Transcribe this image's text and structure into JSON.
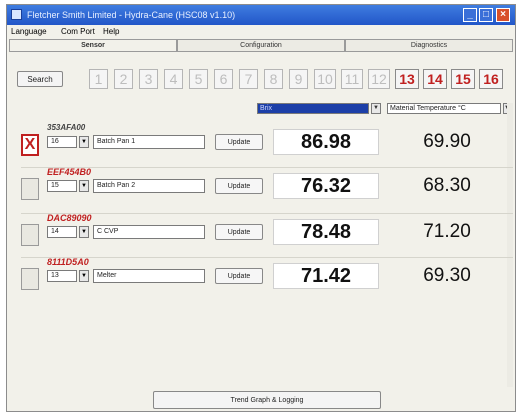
{
  "window": {
    "title": "Fletcher Smith Limited - Hydra-Cane (HSC08 v1.10)"
  },
  "menu": [
    "Language",
    "Com Port",
    "Help"
  ],
  "tabs": [
    {
      "label": "Sensor",
      "active": true
    },
    {
      "label": "Configuration",
      "active": false
    },
    {
      "label": "Diagnostics",
      "active": false
    }
  ],
  "search_label": "Search",
  "channel_buttons": [
    {
      "label": "1",
      "active": false
    },
    {
      "label": "2",
      "active": false
    },
    {
      "label": "3",
      "active": false
    },
    {
      "label": "4",
      "active": false
    },
    {
      "label": "5",
      "active": false
    },
    {
      "label": "6",
      "active": false
    },
    {
      "label": "7",
      "active": false
    },
    {
      "label": "8",
      "active": false
    },
    {
      "label": "9",
      "active": false
    },
    {
      "label": "10",
      "active": false
    },
    {
      "label": "11",
      "active": false
    },
    {
      "label": "12",
      "active": false
    },
    {
      "label": "13",
      "active": true
    },
    {
      "label": "14",
      "active": true
    },
    {
      "label": "15",
      "active": true
    },
    {
      "label": "16",
      "active": true
    }
  ],
  "column_selects": {
    "left": "Brix",
    "right": "Material Temperature °C"
  },
  "sensors": [
    {
      "id": "353AFA00",
      "removed": true,
      "channel": "16",
      "name": "Batch Pan 1",
      "update_label": "Update",
      "brix": "86.98",
      "temperature": "69.90"
    },
    {
      "id": "EEF454B0",
      "removed": false,
      "channel": "15",
      "name": "Batch Pan 2",
      "update_label": "Update",
      "brix": "76.32",
      "temperature": "68.30"
    },
    {
      "id": "DAC89090",
      "removed": false,
      "channel": "14",
      "name": "C CVP",
      "update_label": "Update",
      "brix": "78.48",
      "temperature": "71.20"
    },
    {
      "id": "8111D5A0",
      "removed": false,
      "channel": "13",
      "name": "Melter",
      "update_label": "Update",
      "brix": "71.42",
      "temperature": "69.30"
    }
  ],
  "trend_label": "Trend Graph  & Logging",
  "colors": {
    "title_bar": "#2a5fd0",
    "active_channel": "#c02020",
    "sensor_id": "#c02020"
  }
}
